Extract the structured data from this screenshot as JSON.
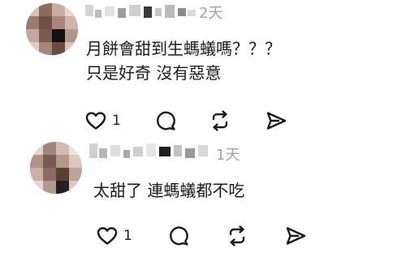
{
  "comments": [
    {
      "time": "2天",
      "lines": [
        "月餅會甜到生螞蟻嗎？？？",
        "只是好奇 沒有惡意"
      ],
      "likes": "1",
      "icons": [
        "heart-icon",
        "comment-icon",
        "repost-icon",
        "share-icon"
      ]
    },
    {
      "time": "1天",
      "lines": [
        "太甜了 連螞蟻都不吃"
      ],
      "likes": "1",
      "icons": [
        "heart-icon",
        "comment-icon",
        "repost-icon",
        "share-icon"
      ]
    }
  ]
}
